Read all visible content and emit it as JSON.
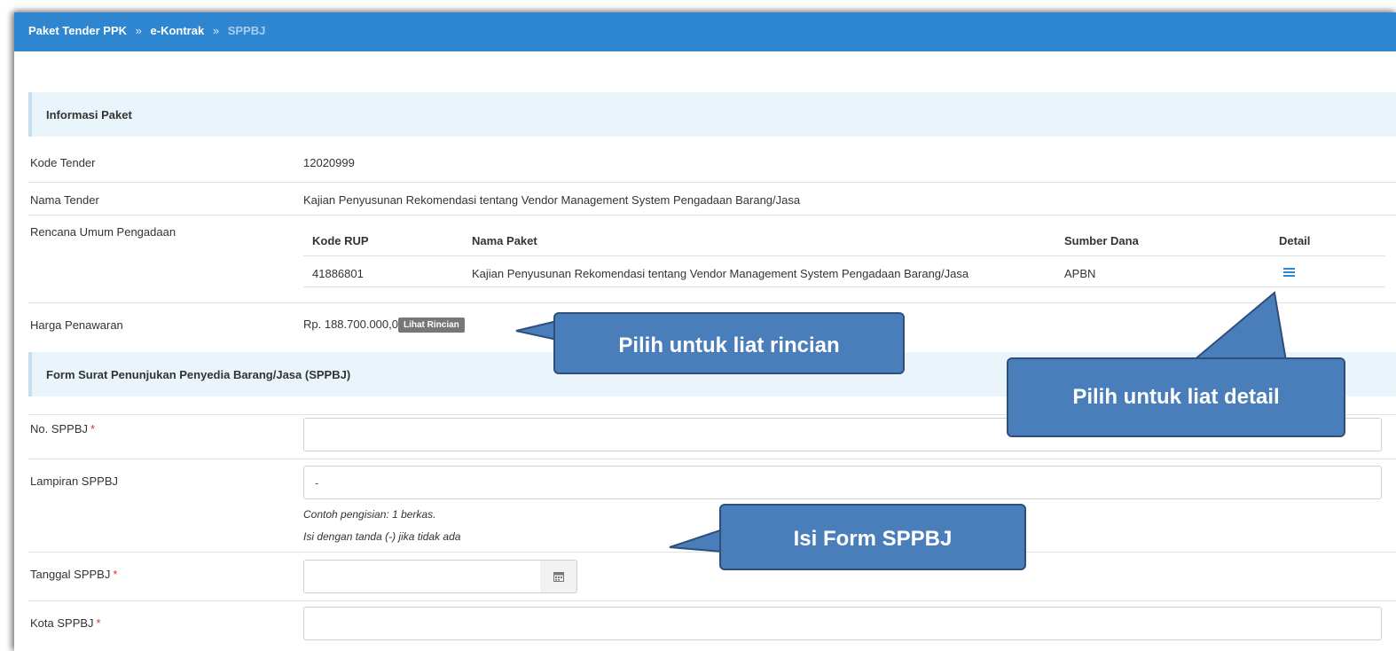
{
  "breadcrumb": {
    "items": [
      "Paket Tender PPK",
      "e-Kontrak",
      "SPPBJ"
    ],
    "separator": "»"
  },
  "info_section": {
    "title": "Informasi Paket",
    "fields": {
      "kode_tender": {
        "label": "Kode Tender",
        "value": "12020999"
      },
      "nama_tender": {
        "label": "Nama Tender",
        "value": "Kajian Penyusunan Rekomendasi tentang Vendor Management System Pengadaan Barang/Jasa"
      },
      "rup": {
        "label": "Rencana Umum Pengadaan"
      },
      "harga": {
        "label": "Harga Penawaran",
        "value": "Rp. 188.700.000,00",
        "button": "Lihat Rincian"
      }
    },
    "rup_table": {
      "headers": [
        "Kode RUP",
        "Nama Paket",
        "Sumber Dana",
        "Detail"
      ],
      "rows": [
        {
          "kode": "41886801",
          "nama": "Kajian Penyusunan Rekomendasi tentang Vendor Management System Pengadaan Barang/Jasa",
          "sumber": "APBN",
          "detail_icon": "list-icon"
        }
      ]
    }
  },
  "form_section": {
    "title": "Form Surat Penunjukan Penyedia Barang/Jasa (SPPBJ)",
    "required_mark": "*",
    "no_sppbj": {
      "label": "No. SPPBJ",
      "value": ""
    },
    "lampiran": {
      "label": "Lampiran SPPBJ",
      "value": "-"
    },
    "hint_1": "Contoh pengisian: 1 berkas.",
    "hint_2": "Isi dengan tanda (-) jika tidak ada",
    "tanggal": {
      "label": "Tanggal SPPBJ",
      "value": "",
      "icon": "calendar-icon"
    },
    "kota": {
      "label": "Kota SPPBJ",
      "value": ""
    }
  },
  "callouts": {
    "rincian": "Pilih untuk liat rincian",
    "detail": "Pilih untuk liat detail",
    "form": "Isi  Form SPPBJ"
  },
  "colors": {
    "topbar": "#2f86d0",
    "section_bg": "#eaf4fb",
    "callout_fill": "#4a7ebb",
    "callout_border": "#2d4f7a",
    "required": "#d9302b"
  }
}
